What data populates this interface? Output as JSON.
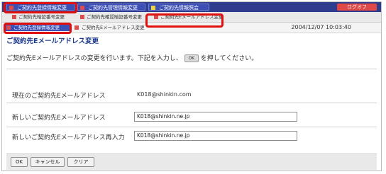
{
  "top_tabs": [
    "ご契約先登録情報変更",
    "ご契約先管理情報変更",
    "ご契約先情報照会"
  ],
  "logout_label": "ログオフ",
  "sub_nav": [
    "ご契約先暗証番号変更",
    "ご契約先確認暗証番号変更",
    "ご契約先Eメールアドレス変更"
  ],
  "breadcrumb": [
    "ご契約先登録情報変更",
    "ご契約先Eメールアドレス変更"
  ],
  "datetime": "2004/12/07 10:03:40",
  "page_title": "ご契約先Eメールアドレス変更",
  "instruction": {
    "before": "ご契約先Eメールアドレスの変更を行います。下記を入力し、",
    "icon_label": "OK",
    "after": "を押してください。"
  },
  "form": {
    "current_label": "現在のご契約先Eメールアドレス",
    "current_value": "K018@shinkin.com",
    "new_label": "新しいご契約先Eメールアドレス",
    "new_value": "K018@shinkin.ne.jp",
    "confirm_label": "新しいご契約先Eメールアドレス再入力",
    "confirm_value": "K018@shinkin.ne.jp"
  },
  "buttons": {
    "ok": "OK",
    "cancel": "キャンセル",
    "clear": "クリア"
  },
  "colors": {
    "topbar": "#2e3d8e",
    "accent_red": "#e01010",
    "title_blue": "#1f3b8f"
  }
}
